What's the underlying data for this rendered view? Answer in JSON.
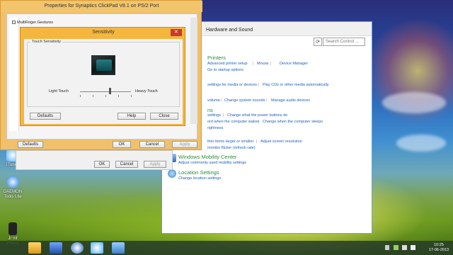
{
  "desktop": {
    "icons": [
      {
        "label": "iTunes"
      },
      {
        "label": "DAEMON Tools Lite"
      },
      {
        "label": "Jr Inf Phone"
      }
    ]
  },
  "control_panel": {
    "title": "Hardware and Sound",
    "search_placeholder": "Search Control ...",
    "sections": {
      "devices_and_printers": {
        "header": "Printers",
        "links": [
          "Advanced printer setup",
          "Mouse",
          "Device Manager"
        ],
        "sublink": "Go to startup options"
      },
      "autoplay": {
        "links": [
          "settings for media or devices",
          "Play CDs or other media automatically"
        ]
      },
      "sound": {
        "links": [
          "volume",
          "Change system sounds",
          "Manage audio devices"
        ]
      },
      "power": {
        "header": "ns",
        "links": [
          "settings",
          "Change what the power buttons do",
          "ord when the computer wakes",
          "Change when the computer sleeps",
          "rightness"
        ]
      },
      "display": {
        "links": [
          "ther items larger or smaller",
          "Adjust screen resolution",
          "monitor flicker (refresh rate)"
        ]
      },
      "mobility": {
        "header": "Windows Mobility Center",
        "link": "Adjust commonly used mobility settings"
      },
      "location": {
        "header": "Location Settings",
        "link": "Change location settings"
      }
    }
  },
  "properties": {
    "title": "Properties for Synaptics ClickPad V8.1 on PS/2 Port",
    "tree_item": "MultiFinger Gestures",
    "buttons": {
      "defaults": "Defaults",
      "ok": "OK",
      "cancel": "Cancel",
      "apply": "Apply"
    }
  },
  "secondary": {
    "buttons": {
      "ok": "OK",
      "cancel": "Cancel",
      "apply": "Apply"
    }
  },
  "sensitivity": {
    "title": "Sensitivity",
    "group_label": "Touch Sensitivity",
    "slider": {
      "min_label": "Light Touch",
      "max_label": "Heavy Touch",
      "level": 0.58
    },
    "buttons": {
      "defaults": "Defaults",
      "help": "Help",
      "close": "Close"
    }
  },
  "taskbar": {
    "clock": {
      "time": "10:25",
      "date": "17-06-2013"
    }
  },
  "colors": {
    "accent_green": "#2d8a3c",
    "link_blue": "#1e5ebd",
    "dialog_orange": "#f5b63e",
    "close_red": "#c83a2e"
  }
}
